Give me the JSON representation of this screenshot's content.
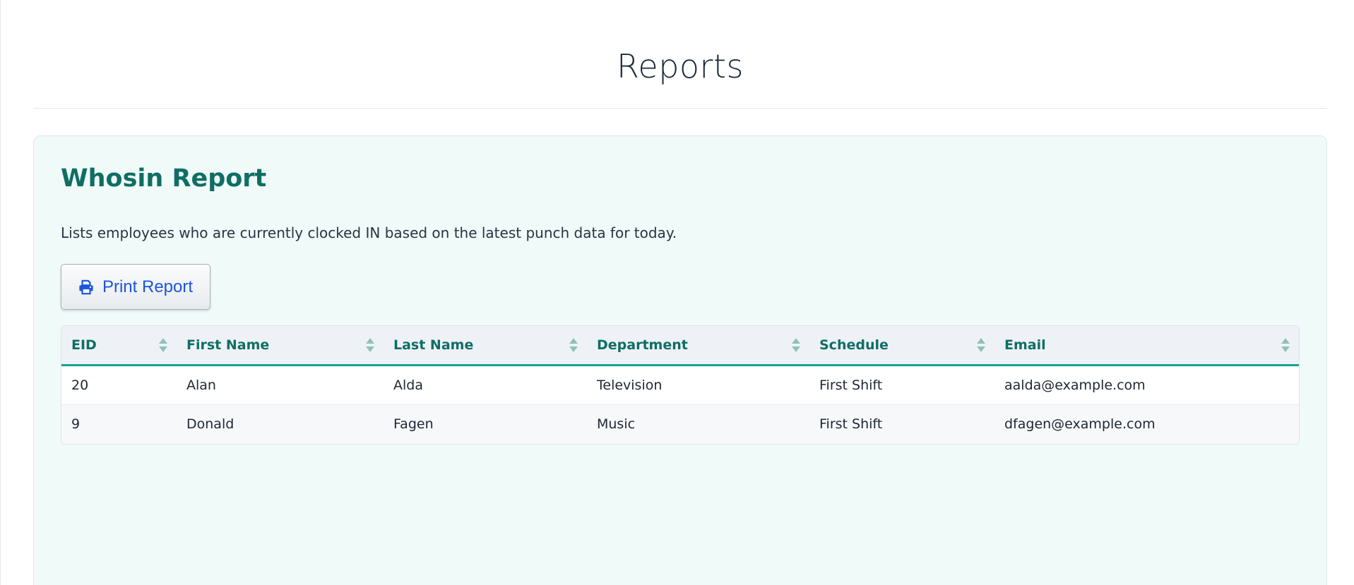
{
  "page": {
    "title": "Reports"
  },
  "report": {
    "title": "Whosin Report",
    "description": "Lists employees who are currently clocked IN based on the latest punch data for today.",
    "print_button_label": "Print Report",
    "print_icon": "printer-icon",
    "sort_icon": "sort-arrows-icon"
  },
  "table": {
    "headers": [
      "EID",
      "First Name",
      "Last Name",
      "Department",
      "Schedule",
      "Email"
    ],
    "rows": [
      [
        "20",
        "Alan",
        "Alda",
        "Television",
        "First Shift",
        "aalda@example.com"
      ],
      [
        "9",
        "Donald",
        "Fagen",
        "Music",
        "First Shift",
        "dfagen@example.com"
      ]
    ]
  },
  "colors": {
    "accent": "#0f6e64",
    "header_underline": "#14a38f",
    "card_background": "#f0faf8",
    "button_text": "#1a56db"
  }
}
